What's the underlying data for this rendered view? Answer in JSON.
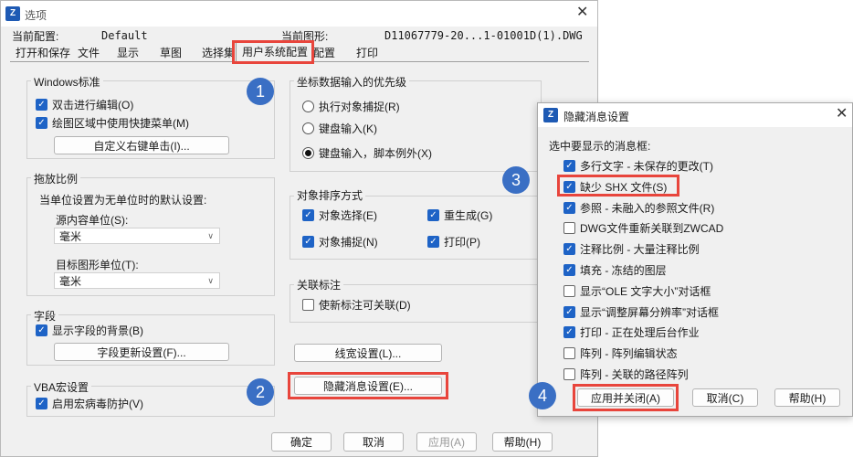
{
  "window": {
    "title": "选项",
    "close": "✕",
    "current_config_label": "当前配置:",
    "current_config_value": "Default",
    "current_drawing_label": "当前图形:",
    "current_drawing_value": "D11067779-20...1-01001D(1).DWG"
  },
  "tabs": [
    {
      "label": "打开和保存"
    },
    {
      "label": "文件"
    },
    {
      "label": "显示"
    },
    {
      "label": "草图"
    },
    {
      "label": "选择集"
    },
    {
      "label": "用户系统配置"
    },
    {
      "label": "配置"
    },
    {
      "label": "打印"
    }
  ],
  "windows_std": {
    "title": "Windows标准",
    "dblclick": {
      "label": "双击进行编辑(O)",
      "checked": true
    },
    "shortcut": {
      "label": "绘图区域中使用快捷菜单(M)",
      "checked": true
    },
    "custom_btn": "自定义右键单击(I)..."
  },
  "scale": {
    "title": "拖放比例",
    "desc": "当单位设置为无单位时的默认设置:",
    "src_label": "源内容单位(S):",
    "src_value": "毫米",
    "tgt_label": "目标图形单位(T):",
    "tgt_value": "毫米"
  },
  "field": {
    "title": "字段",
    "bg": {
      "label": "显示字段的背景(B)",
      "checked": true
    },
    "update_btn": "字段更新设置(F)..."
  },
  "vba": {
    "title": "VBA宏设置",
    "virus": {
      "label": "启用宏病毒防护(V)",
      "checked": true
    }
  },
  "coord": {
    "title": "坐标数据输入的优先级",
    "options": [
      {
        "label": "执行对象捕捉(R)",
        "selected": false
      },
      {
        "label": "键盘输入(K)",
        "selected": false
      },
      {
        "label": "键盘输入，脚本例外(X)",
        "selected": true
      }
    ]
  },
  "sort": {
    "title": "对象排序方式",
    "items": [
      {
        "label": "对象选择(E)",
        "checked": true
      },
      {
        "label": "重生成(G)",
        "checked": true
      },
      {
        "label": "对象捕捉(N)",
        "checked": true
      },
      {
        "label": "打印(P)",
        "checked": true
      }
    ]
  },
  "assoc": {
    "title": "关联标注",
    "dim": {
      "label": "使新标注可关联(D)",
      "checked": false
    }
  },
  "lineweight_btn": "线宽设置(L)...",
  "hidden_msg_btn": "隐藏消息设置(E)...",
  "footer": {
    "ok": "确定",
    "cancel": "取消",
    "apply": "应用(A)",
    "help": "帮助(H)"
  },
  "dialog": {
    "title": "隐藏消息设置",
    "close": "✕",
    "prompt": "选中要显示的消息框:",
    "items": [
      {
        "label": "多行文字 - 未保存的更改(T)",
        "checked": true
      },
      {
        "label": "缺少 SHX 文件(S)",
        "checked": true
      },
      {
        "label": "参照 - 未融入的参照文件(R)",
        "checked": true
      },
      {
        "label": "DWG文件重新关联到ZWCAD",
        "checked": false
      },
      {
        "label": "注释比例 - 大量注释比例",
        "checked": true
      },
      {
        "label": "填充 - 冻结的图层",
        "checked": true
      },
      {
        "label": "显示“OLE 文字大小”对话框",
        "checked": false
      },
      {
        "label": "显示“调整屏幕分辨率”对话框",
        "checked": true
      },
      {
        "label": "打印 - 正在处理后台作业",
        "checked": true
      },
      {
        "label": "阵列 - 阵列编辑状态",
        "checked": false
      },
      {
        "label": "阵列 - 关联的路径阵列",
        "checked": false
      }
    ],
    "apply_close": "应用并关闭(A)",
    "cancel": "取消(C)",
    "help": "帮助(H)"
  },
  "badges": [
    "1",
    "2",
    "3",
    "4"
  ],
  "icons": {
    "app": "app-logo-icon",
    "check": "✓",
    "chevron": "∨"
  },
  "colors": {
    "highlight": "#e8453c",
    "badge": "#3a6fc4",
    "checkbox": "#1e63c6"
  }
}
